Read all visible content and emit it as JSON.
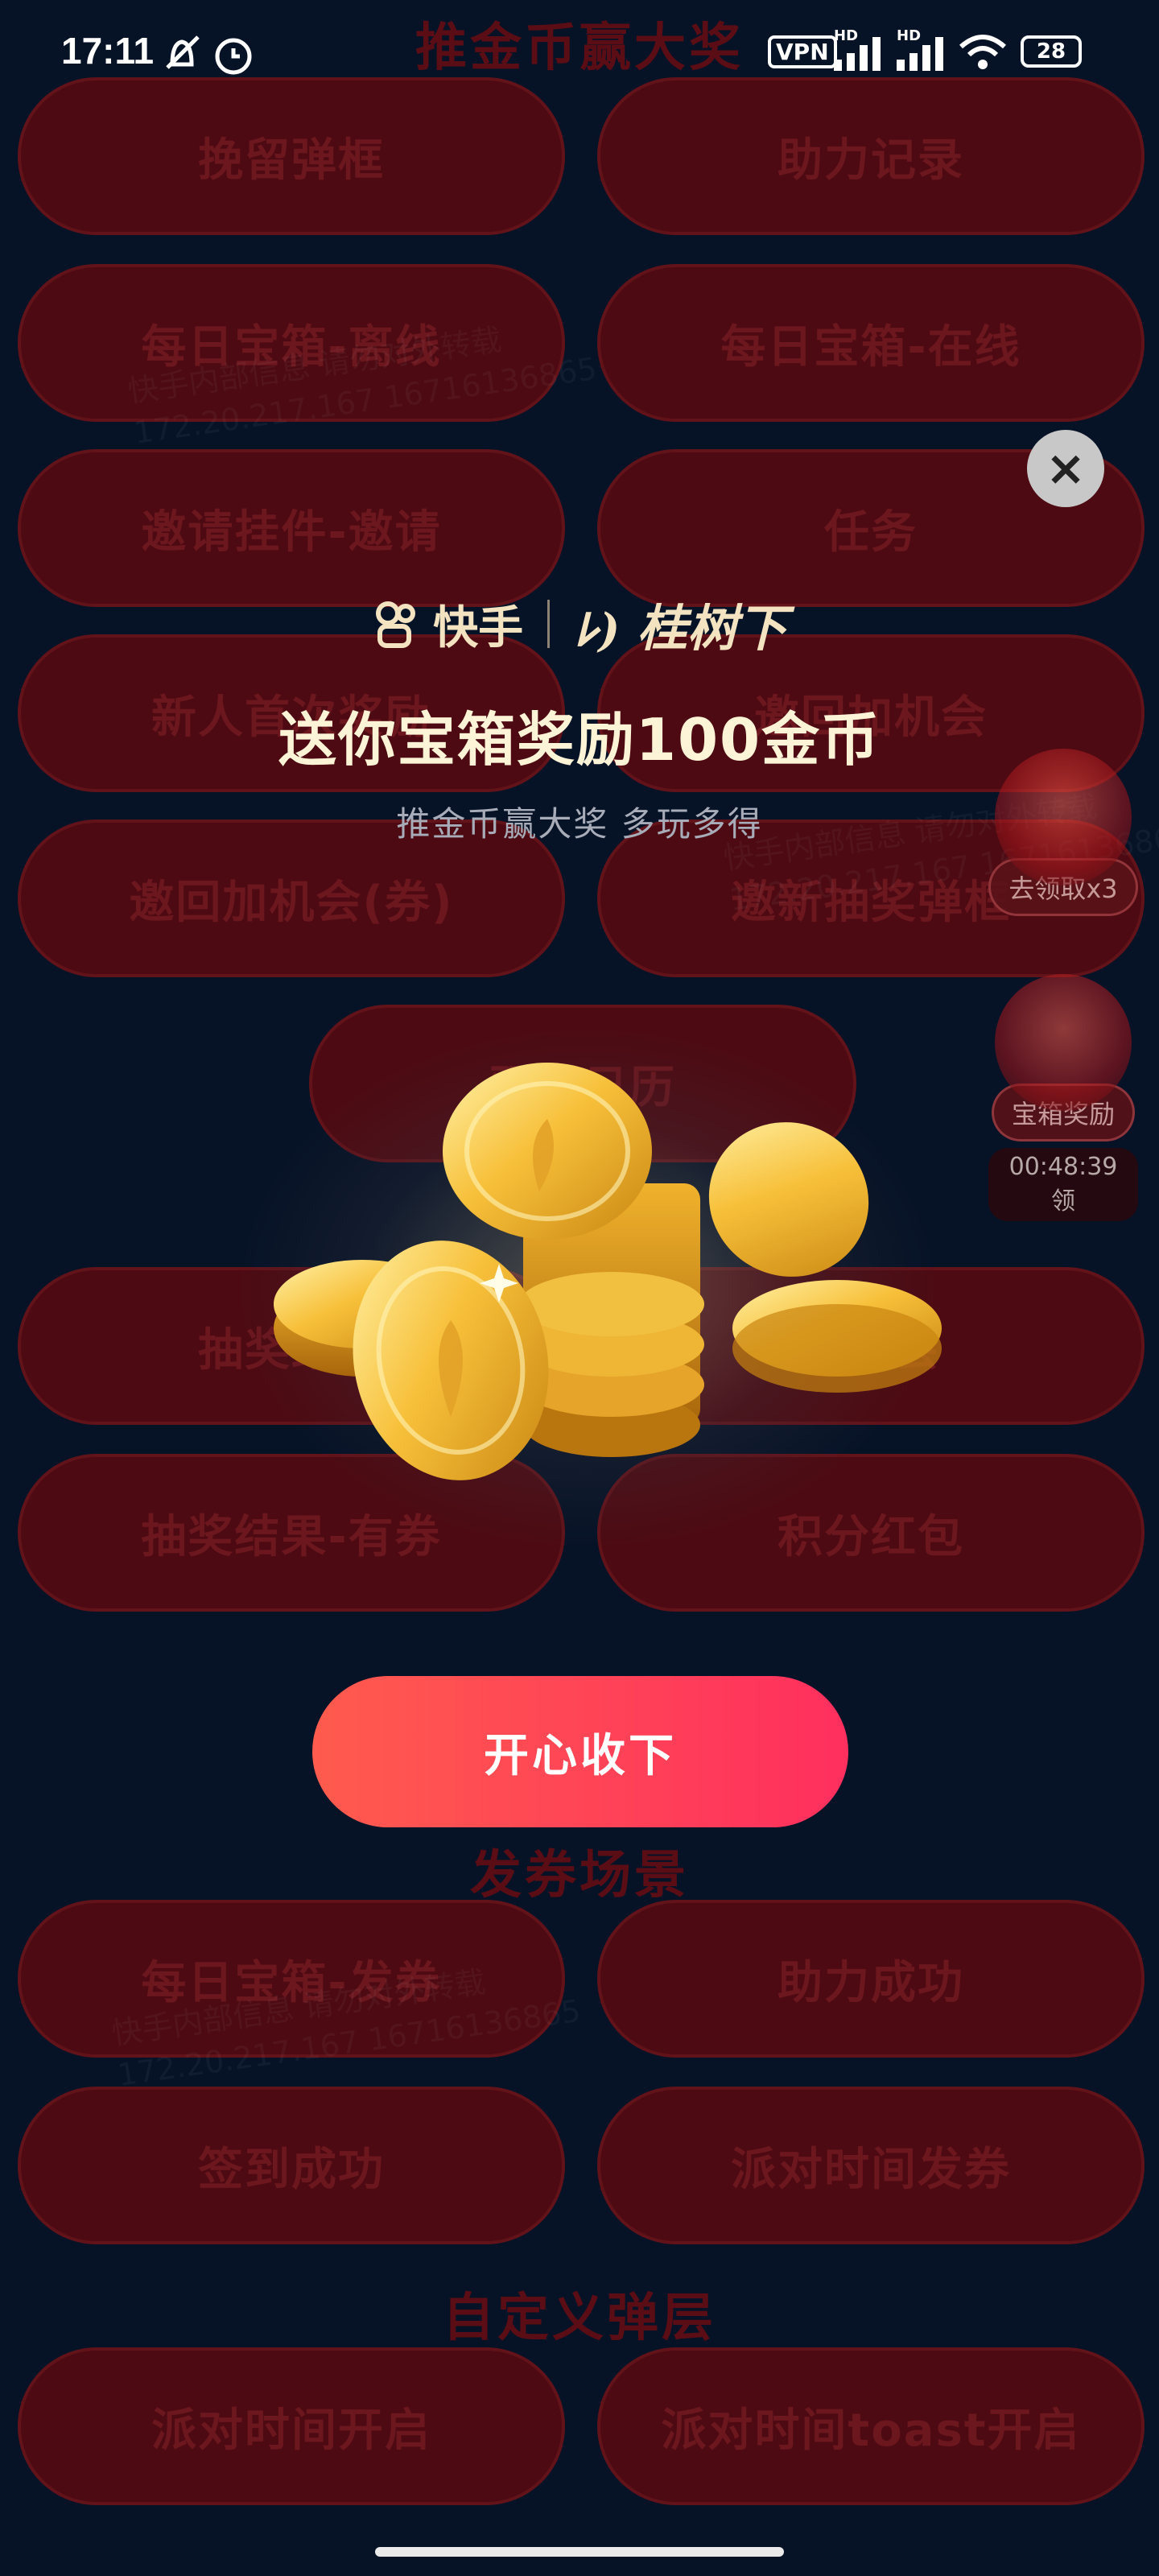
{
  "status_bar": {
    "time": "17:11",
    "vpn": "VPN",
    "hd1": "HD",
    "hd2": "HD",
    "battery": "28"
  },
  "background": {
    "top_title": "推金币赢大奖",
    "rows": [
      [
        "挽留弹框",
        "助力记录"
      ],
      [
        "每日宝箱-离线",
        "每日宝箱-在线"
      ],
      [
        "邀请挂件-邀请",
        "任务"
      ],
      [
        "新人首次奖励",
        "邀回加机会"
      ],
      [
        "邀回加机会(券)",
        "邀新抽奖弹框"
      ],
      [
        "预约日历"
      ],
      [
        "抽奖结果",
        "有机会"
      ],
      [
        "抽奖结果-有券",
        "积分红包"
      ]
    ],
    "section2_title": "发券场景",
    "rows2": [
      [
        "每日宝箱-发券",
        "助力成功"
      ],
      [
        "签到成功",
        "派对时间发券"
      ]
    ],
    "section3_title": "自定义弹层",
    "rows3": [
      [
        "派对时间开启",
        "派对时间toast开启"
      ]
    ],
    "watermark_line1": "快手内部信息 请勿对外转载",
    "watermark_line2": "172.20.217.167 16716136865"
  },
  "floats": {
    "claim_label": "去领取x3",
    "chest_label": "宝箱奖励",
    "chest_timer": "00:48:39领"
  },
  "modal": {
    "brand_kuaishou": "快手",
    "brand_partner": "桂树下",
    "headline": "送你宝箱奖励100金币",
    "subtitle": "推金币赢大奖 多玩多得",
    "cta": "开心收下",
    "close_glyph": "×"
  },
  "colors": {
    "background": "#061226",
    "cta_start": "#ff5b4e",
    "cta_end": "#ff2f5e",
    "gold": "#f5c542"
  }
}
